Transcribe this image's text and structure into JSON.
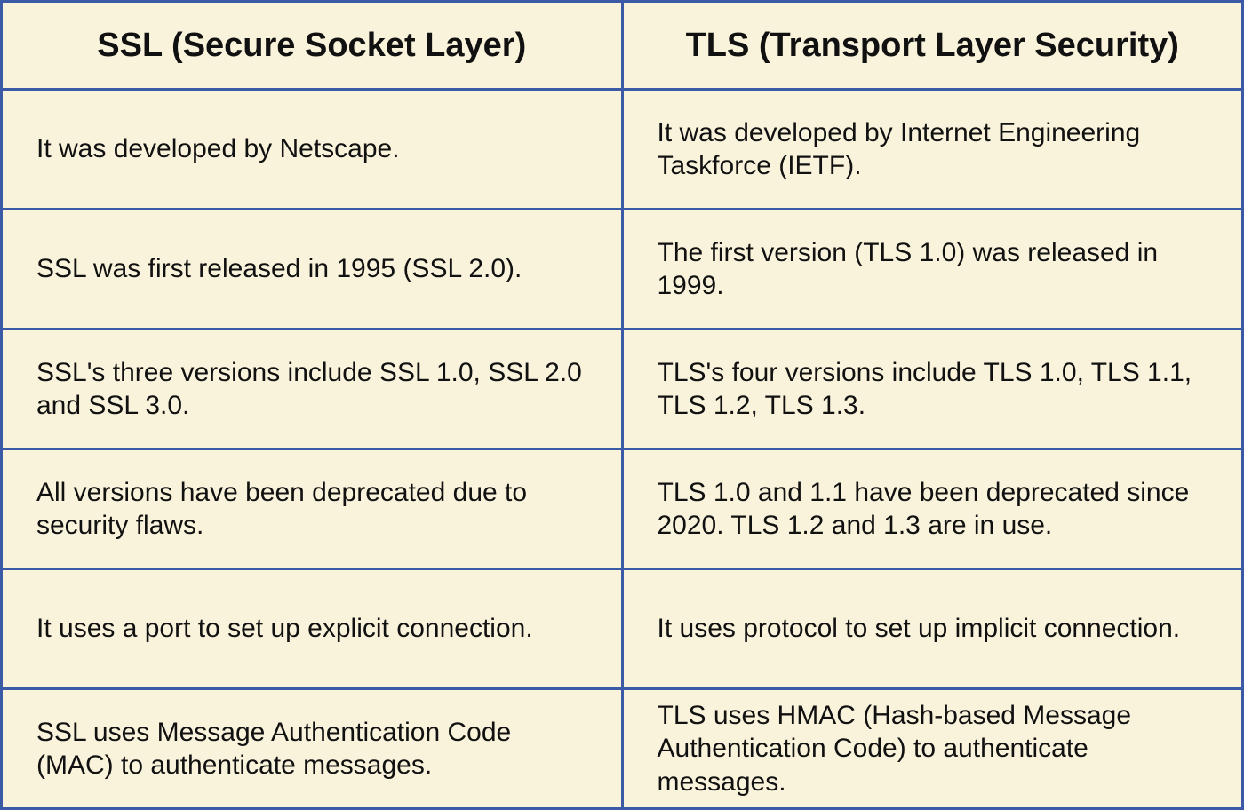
{
  "table": {
    "headers": {
      "col1": "SSL (Secure Socket Layer)",
      "col2": "TLS (Transport Layer Security)"
    },
    "rows": [
      {
        "ssl": "It was developed by Netscape.",
        "tls": "It was developed by Internet Engineering Taskforce (IETF)."
      },
      {
        "ssl": "SSL was first released in 1995 (SSL 2.0).",
        "tls": "The first version (TLS 1.0) was released in 1999."
      },
      {
        "ssl": "SSL's three versions include SSL 1.0, SSL 2.0 and SSL 3.0.",
        "tls": "TLS's four versions include TLS 1.0, TLS 1.1, TLS 1.2, TLS 1.3."
      },
      {
        "ssl": "All versions have been deprecated due to security flaws.",
        "tls": "TLS 1.0 and 1.1 have been deprecated since 2020. TLS 1.2 and 1.3 are in use."
      },
      {
        "ssl": "It uses a port to set up explicit connection.",
        "tls": "It uses protocol to set up implicit connection."
      },
      {
        "ssl": "SSL uses Message Authentication Code (MAC) to authenticate messages.",
        "tls": "TLS uses HMAC (Hash-based Message Authentication Code) to authenticate messages."
      }
    ]
  }
}
